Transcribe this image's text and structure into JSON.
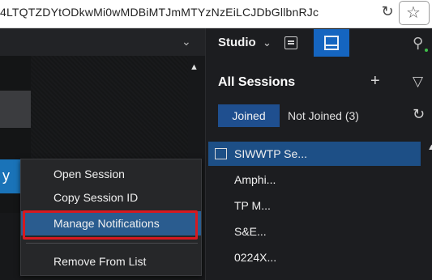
{
  "browser": {
    "url_fragment": "4LTQTZDYtODkwMi0wMDBiMTJmMTYzNzEiLCJDbGllbnRJc",
    "reload_icon": "reload-icon",
    "star_icon": "star-icon"
  },
  "context_menu": {
    "items": [
      {
        "label": "Open Session"
      },
      {
        "label": "Copy Session ID"
      },
      {
        "label": "Manage Notifications"
      },
      {
        "label": "Remove From List"
      }
    ],
    "highlight_color": "#d71920",
    "selected_color": "#2a5c8f"
  },
  "left_pane": {
    "tab_label": "y"
  },
  "panel": {
    "studio_label": "Studio",
    "title": "All Sessions",
    "tabs": [
      {
        "label": "Joined",
        "active": true
      },
      {
        "label": "Not Joined (3)",
        "active": false
      }
    ],
    "accent_color": "#1565c0"
  },
  "sessions": [
    {
      "name": "SIWWTP Se...",
      "selected": true
    },
    {
      "name": "Amphi..."
    },
    {
      "name": "TP M..."
    },
    {
      "name": "S&E..."
    },
    {
      "name": "0224X..."
    }
  ]
}
